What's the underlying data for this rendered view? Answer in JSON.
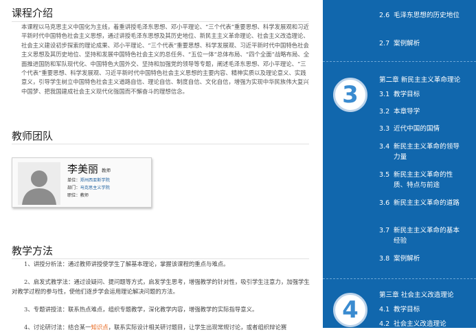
{
  "intro": {
    "title": "课程介绍",
    "text": "本课程以马克思主义中国化为主线，着重讲授毛泽东思想、邓小平理论、“三个代表”重要思想、科学发展观和习近平新时代中国特色社会主义思想，通过讲授毛泽东思想及其历史地位、新民主主义革命理论、社会主义改造理论、社会主义建设初步探索的理论成果、邓小平理论、“三个代表”重要思想、科学发展观、习近平新时代中国特色社会主义思想及其历史地位、坚持和发展中国特色社会主义的总任务、“五位一体”总体布局、“四个全面”战略布局、全面推进国防和军队现代化、中国特色大国外交、坚持和加强党的领导等专题，阐述毛泽东思想、邓小平理论、“三个代表”重要思想、科学发展观、习近平新时代中国特色社会主义思想的主要内容、精神实质以及理论意义、实践意义，引导学生树立中国特色社会主义道路自信、理论自信、制度自信、文化自信，增强为实现中华民族伟大复兴中国梦、把我国建成社会主义现代化强国而不懈奋斗的理想信念。"
  },
  "team": {
    "title": "教师团队",
    "teacher": {
      "name": "李美丽",
      "role": "教师",
      "unit_label": "单位：",
      "unit": "郑州西亚斯学院",
      "dept_label": "部门：",
      "dept": "马克思主义学院",
      "title_label": "职位：",
      "title": "教师"
    }
  },
  "methods": {
    "title": "教学方法",
    "items": [
      "1、讲授分析法：通过教师讲授使学生了解基本理论，掌握该课程的重点与难点。",
      "2、启发式教学法：通过设疑问、提问题等方式，启发学生思考，增强教学的针对性，吸引学生注意力，加强学生对教学过程的参与性，使他们逐步学会运用理论解决问题的方法。",
      "3、专题讲授法：联系热点难点，组织专题教学，深化教学内容，增强教学的实际指导意义。"
    ],
    "item4_a": "4、讨论研讨法：结合某一",
    "item4_link": "知识点",
    "item4_b": "，联系实际设计相关研讨题目，让学生出现常规讨论，或者组织辩论赛"
  },
  "sidebar": {
    "items_top": [
      {
        "num": "2.6",
        "label": "毛泽东思想的历史地位"
      },
      {
        "num": "2.7",
        "label": "案例解析"
      }
    ],
    "chapter3": {
      "number": "3",
      "title": "第二章 新民主主义革命理论",
      "items": [
        {
          "num": "3.1",
          "label": "教学目标"
        },
        {
          "num": "3.2",
          "label": "本章导学"
        },
        {
          "num": "3.3",
          "label": "近代中国的国情"
        },
        {
          "num": "3.4",
          "label": "新民主主义革命的领导力量"
        },
        {
          "num": "3.5",
          "label": "新民主主义革命的性质、特点与前途"
        },
        {
          "num": "3.6",
          "label": "新民主主义革命的道路"
        },
        {
          "num": "3.7",
          "label": "新民主主义革命的基本经验"
        },
        {
          "num": "3.8",
          "label": "案例解析"
        }
      ]
    },
    "chapter4": {
      "number": "4",
      "title": "第三章 社会主义改造理论",
      "items": [
        {
          "num": "4.1",
          "label": "教学目标"
        },
        {
          "num": "4.2",
          "label": "社会主义改造理论"
        }
      ]
    }
  }
}
